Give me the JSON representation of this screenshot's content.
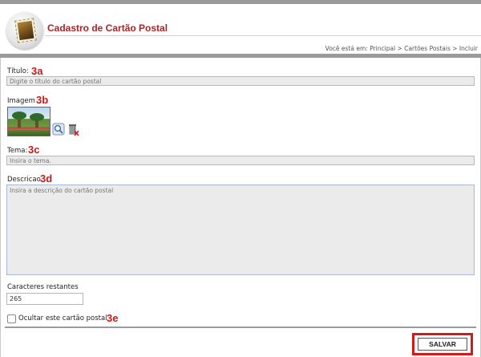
{
  "header": {
    "title": "Cadastro de Cartão Postal",
    "logo_icon": "postage-stamp-icon",
    "breadcrumb": "Você está em: Principal > Cartões Postais > Incluir"
  },
  "form": {
    "titulo": {
      "label": "Título:",
      "callout": "3a",
      "placeholder": "Digite o título do cartão postal"
    },
    "imagem": {
      "label": "Imagem",
      "callout": "3b",
      "view_icon": "magnifier-icon",
      "delete_icon": "trash-icon"
    },
    "tema": {
      "label": "Tema:",
      "callout": "3c",
      "placeholder": "Insira o tema."
    },
    "descricao": {
      "label": "Descricao",
      "callout": "3d",
      "placeholder": "Insira a descrição do cartão postal"
    },
    "caracteres": {
      "label": "Caracteres restantes",
      "value": "265"
    },
    "ocultar": {
      "label": "Ocultar este cartão postal",
      "callout": "3e",
      "checked": false
    },
    "save_label": "SALVAR"
  },
  "colors": {
    "accent": "#b02020",
    "callout": "#c31a1a",
    "bar": "#9a9a9a"
  }
}
